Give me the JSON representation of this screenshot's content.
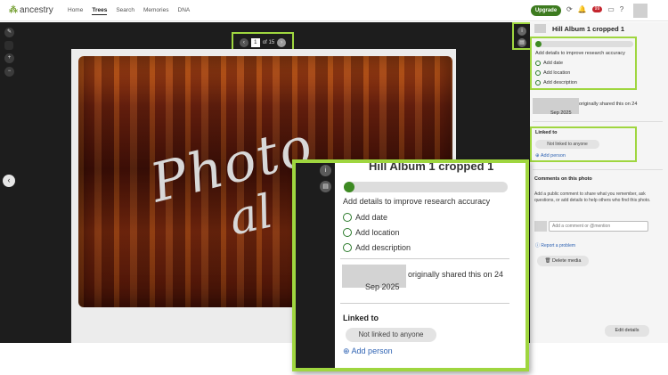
{
  "nav": {
    "logo_text": "ancestry",
    "links": [
      "Home",
      "Trees",
      "Search",
      "Memories",
      "DNA"
    ],
    "active_link": "Trees",
    "upgrade_label": "Upgrade",
    "notification_count": "99"
  },
  "viewer": {
    "page_input": "1",
    "page_text": "of 15",
    "album_text_line1": "Photo",
    "album_text_line2": "al"
  },
  "panel": {
    "title": "Hill Album 1 cropped 1",
    "details_prompt": "Add details to improve research accuracy",
    "options": [
      "Add date",
      "Add location",
      "Add description"
    ],
    "shared_text": "originally shared this on 24",
    "shared_date": "Sep 2025",
    "linked_label": "Linked to",
    "not_linked": "Not linked to anyone",
    "add_person": "Add person",
    "comments_title": "Comments on this photo",
    "comments_desc": "Add a public comment to share what you remember, ask questions, or add details to help others who find this photo.",
    "comment_placeholder": "Add a comment or @mention",
    "report_label": "Report a problem",
    "delete_label": "Delete media",
    "edit_label": "Edit details"
  },
  "colors": {
    "highlight": "#9fd63f",
    "brand_green": "#3d7b1f",
    "link_blue": "#2f63b3"
  }
}
